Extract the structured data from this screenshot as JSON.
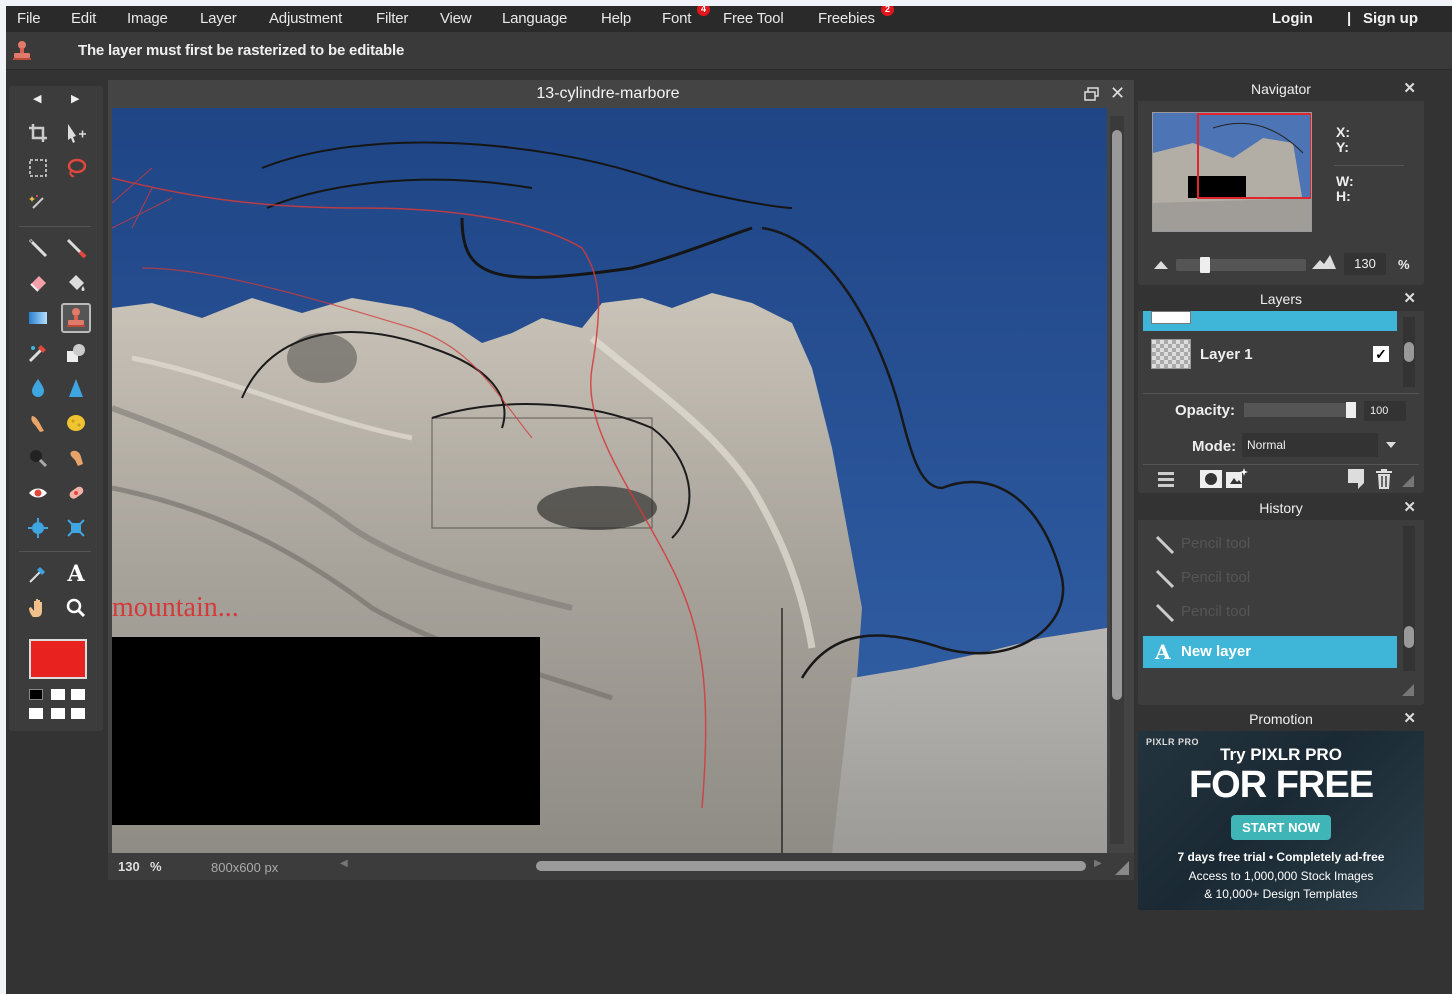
{
  "menu": {
    "items": [
      "File",
      "Edit",
      "Image",
      "Layer",
      "Adjustment",
      "Filter",
      "View",
      "Language",
      "Help",
      "Font",
      "Free Tool",
      "Freebies"
    ],
    "font_badge": "4",
    "freebies_badge": "2",
    "login": "Login",
    "separator": "|",
    "signup": "Sign up"
  },
  "options": {
    "message": "The layer must first be rasterized to be editable"
  },
  "canvas": {
    "title": "13-cylindre-marbore",
    "overlay_text": "mountain...",
    "zoom": "130",
    "zoom_unit": "%",
    "dimensions": "800x600 px"
  },
  "colors": {
    "foreground": "#e8231f",
    "accent": "#3fb5d7",
    "menubar": "#2a2a2a"
  },
  "navigator": {
    "title": "Navigator",
    "x_label": "X:",
    "y_label": "Y:",
    "w_label": "W:",
    "h_label": "H:",
    "zoom_value": "130",
    "zoom_unit": "%",
    "zoom_level": 0.2
  },
  "layers": {
    "title": "Layers",
    "items": [
      {
        "name": ""
      },
      {
        "name": "Layer 1",
        "visible": true
      }
    ],
    "opacity_label": "Opacity:",
    "opacity_value": "100",
    "mode_label": "Mode:",
    "mode_value": "Normal"
  },
  "history": {
    "title": "History",
    "items": [
      "Pencil tool",
      "Pencil tool",
      "Pencil tool",
      "New layer"
    ]
  },
  "promotion": {
    "title": "Promotion",
    "brand": "PIXLR PRO",
    "line1": "Try PIXLR PRO",
    "headline": "FOR FREE",
    "cta": "START NOW",
    "trial": "7 days free trial • Completely ad-free",
    "feature1": "Access to 1,000,000 Stock Images",
    "feature2": "& 10,000+ Design Templates"
  }
}
